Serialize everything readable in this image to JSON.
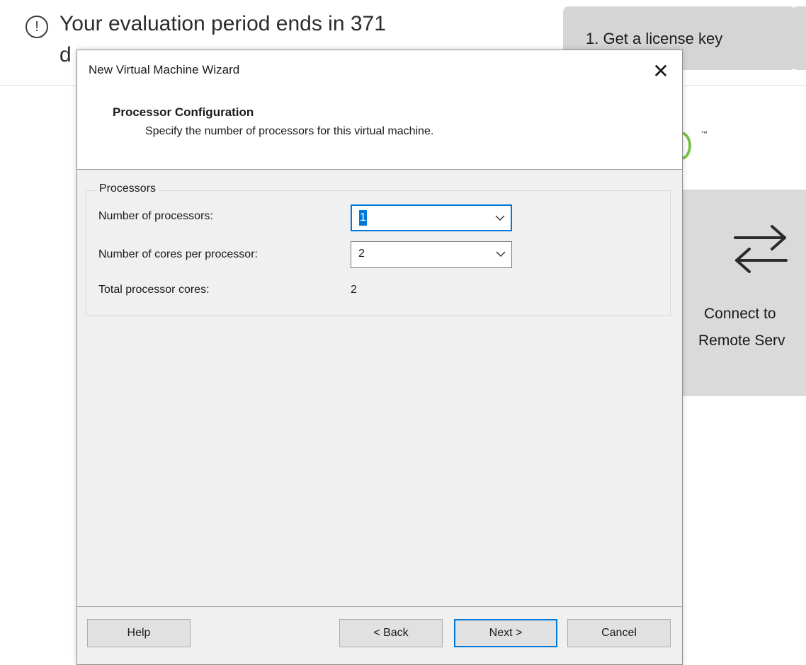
{
  "background": {
    "eval_notice_line1": "Your evaluation period ends in 371",
    "eval_notice_line2": "d",
    "license_button": "1. Get a license key",
    "remote_tile_line1": "Connect to",
    "remote_tile_line2": "Remote Serv",
    "tm_mark": "™",
    "accent_color": "#7ac143"
  },
  "dialog": {
    "title": "New Virtual Machine Wizard",
    "close_glyph": "✕",
    "header": {
      "title": "Processor Configuration",
      "subtitle": "Specify the number of processors for this virtual machine."
    },
    "group": {
      "legend": "Processors",
      "num_processors_label": "Number of processors:",
      "num_processors_value": "1",
      "cores_label": "Number of cores per processor:",
      "cores_value": "2",
      "total_label": "Total processor cores:",
      "total_value": "2"
    },
    "buttons": {
      "help": "Help",
      "back": "< Back",
      "next": "Next >",
      "cancel": "Cancel"
    },
    "focus_color": "#0078d7"
  }
}
